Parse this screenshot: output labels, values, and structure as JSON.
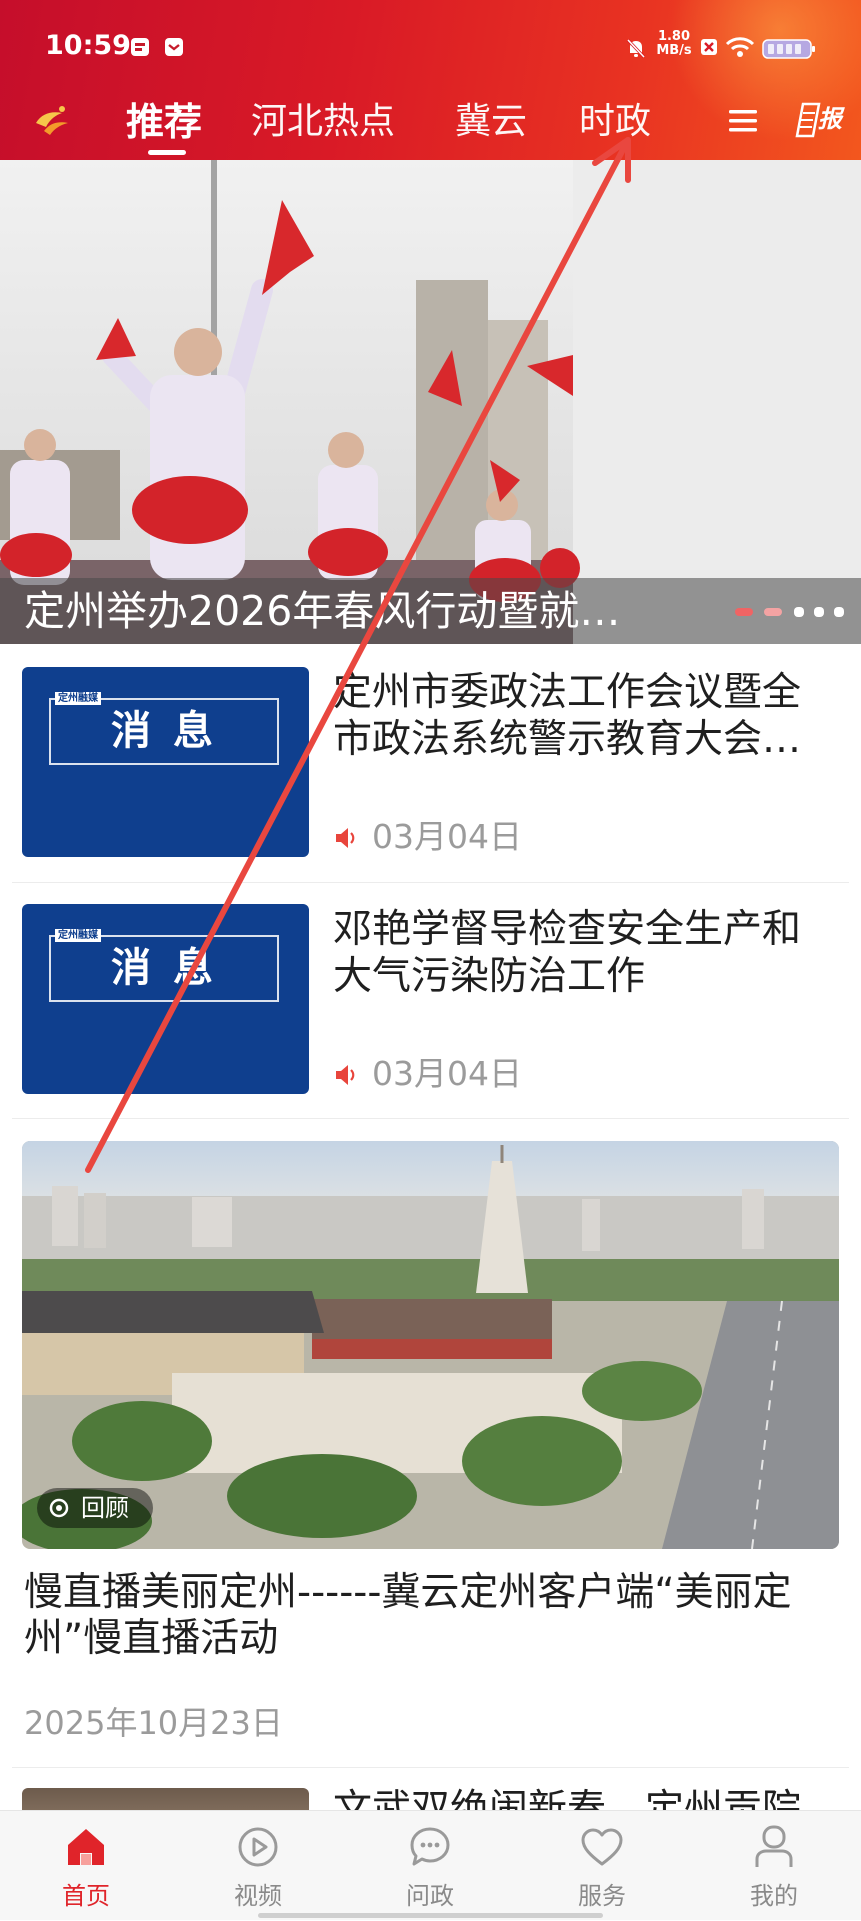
{
  "status_bar": {
    "time": "10:59",
    "net_speed": "1.80",
    "net_speed_unit": "MB/s",
    "icons": [
      "message-app-icon",
      "notification-app-icon",
      "bell-off-icon",
      "no-sim-icon",
      "wifi-icon",
      "battery-icon"
    ]
  },
  "header": {
    "logo_icon": "jiyun-logo-icon",
    "tabs": [
      {
        "label": "推荐",
        "active": true
      },
      {
        "label": "河北热点",
        "active": false
      },
      {
        "label": "冀云",
        "active": false
      },
      {
        "label": "时政",
        "active": false
      }
    ],
    "menu_icon": "menu-icon",
    "epaper_icon": "epaper-icon",
    "epaper_label": "报"
  },
  "hero": {
    "caption": "定州举办2026年春风行动暨就…",
    "slide_count": 5,
    "active_slide": 0
  },
  "news": [
    {
      "thumb_tag": "定州融媒",
      "thumb_label": "消 息",
      "title": "定州市委政法工作会议暨全市政法系统警示教育大会…",
      "audio_icon": "speaker-icon",
      "date": "03月04日"
    },
    {
      "thumb_tag": "定州融媒",
      "thumb_label": "消 息",
      "title": "邓艳学督导检查安全生产和大气污染防治工作",
      "audio_icon": "speaker-icon",
      "date": "03月04日"
    }
  ],
  "featured": {
    "badge_icon": "replay-icon",
    "badge": "回顾",
    "title": "慢直播美丽定州------冀云定州客户端“美丽定州”慢直播活动",
    "date": "2025年10月23日"
  },
  "partial_item": {
    "title": "文武双绝闹新春　定州贡院"
  },
  "bottom_nav": [
    {
      "label": "首页",
      "icon": "home-icon",
      "active": true
    },
    {
      "label": "视频",
      "icon": "video-icon",
      "active": false
    },
    {
      "label": "问政",
      "icon": "chat-icon",
      "active": false
    },
    {
      "label": "服务",
      "icon": "heart-icon",
      "active": false
    },
    {
      "label": "我的",
      "icon": "user-icon",
      "active": false
    }
  ],
  "colors": {
    "header_start": "#c50e2b",
    "header_end": "#f3571e",
    "accent": "#e0242a",
    "thumb_blue": "#0f3f8e",
    "muted_text": "#9b9b9b",
    "annotation_arrow": "#e9473f"
  }
}
